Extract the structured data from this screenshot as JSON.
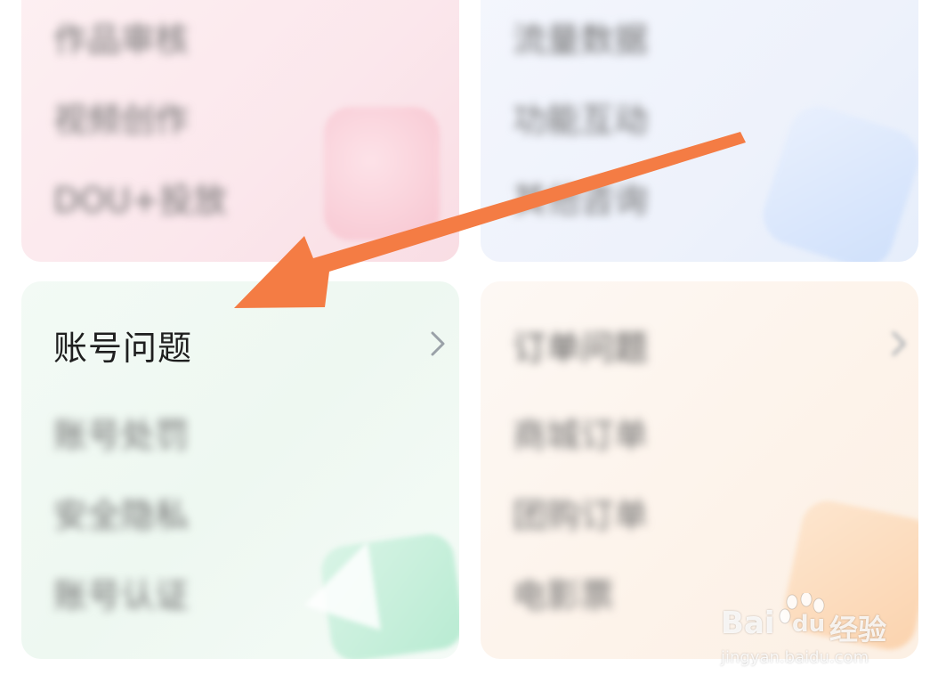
{
  "cards": {
    "works": {
      "items": [
        "作品审核",
        "视频创作",
        "DOU+投放"
      ]
    },
    "traffic": {
      "items": [
        "流量数据",
        "功能互动",
        "其他咨询"
      ]
    },
    "account": {
      "title": "账号问题",
      "items": [
        "账号处罚",
        "安全隐私",
        "账号认证"
      ]
    },
    "orders": {
      "title": "订单问题",
      "items": [
        "商城订单",
        "团购订单",
        "电影票"
      ]
    }
  },
  "watermark": {
    "brand_bai": "Bai",
    "brand_du": "du",
    "brand_jy": "经验",
    "url": "jingyan.baidu.com"
  },
  "colors": {
    "arrow": "#f47c44",
    "title_text": "#1f1f1f",
    "chevron": "#9aa1a8"
  },
  "icons": [
    "chevron-right-icon",
    "annotation-arrow-icon",
    "baidu-paw-icon"
  ]
}
